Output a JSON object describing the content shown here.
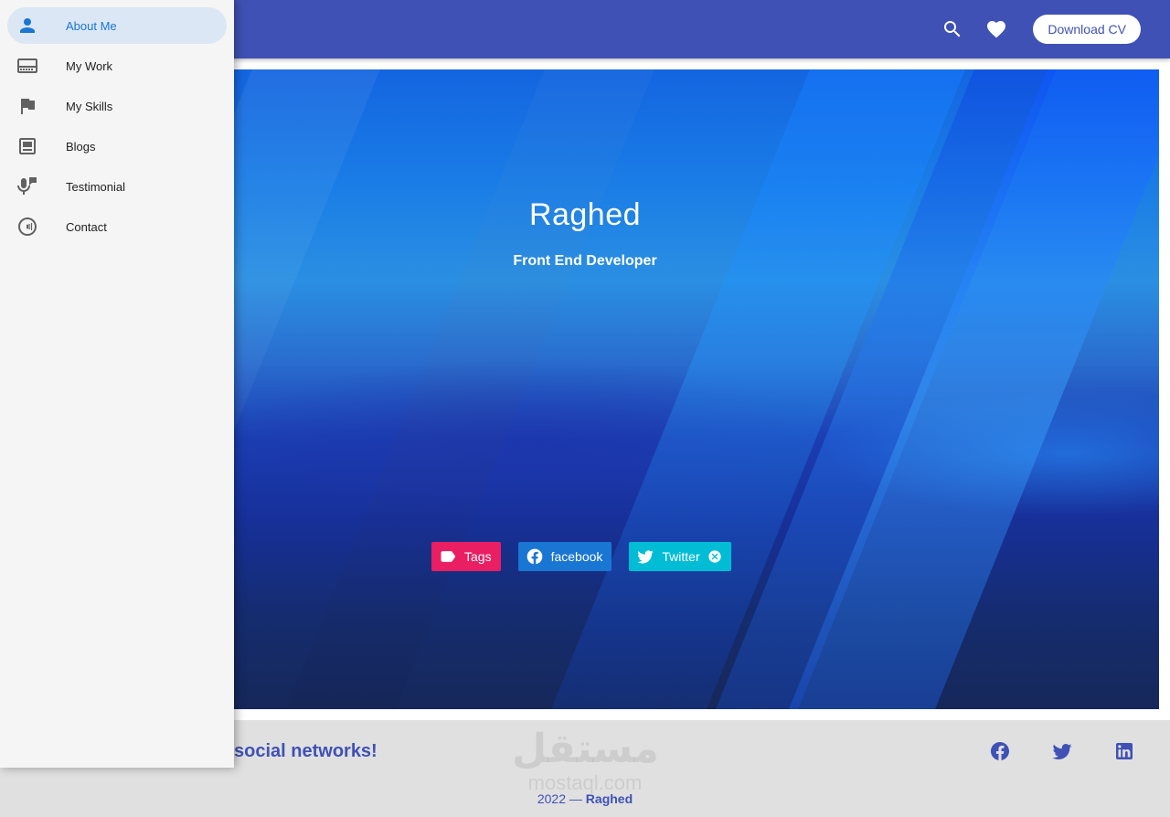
{
  "app_bar": {
    "search_icon": "search-icon",
    "favorite_icon": "heart-icon",
    "download_label": "Download CV",
    "color": "#3f51b5"
  },
  "drawer": {
    "items": [
      {
        "label": "About Me",
        "icon": "person-icon",
        "active": true
      },
      {
        "label": "My Work",
        "icon": "work-display-icon",
        "active": false
      },
      {
        "label": "My Skills",
        "icon": "flag-icon",
        "active": false
      },
      {
        "label": "Blogs",
        "icon": "article-icon",
        "active": false
      },
      {
        "label": "Testimonial",
        "icon": "mic-feedback-icon",
        "active": false
      },
      {
        "label": "Contact",
        "icon": "broadcast-icon",
        "active": false
      }
    ]
  },
  "hero": {
    "title": "Raghed",
    "subtitle": "Front End Developer",
    "chips": [
      {
        "label": "Tags",
        "icon": "label-icon",
        "color": "#e91e63"
      },
      {
        "label": "facebook",
        "icon": "facebook-icon",
        "color": "#1976d2"
      },
      {
        "label": "Twitter",
        "icon": "twitter-icon",
        "color": "#00bcd4",
        "closable": true
      }
    ]
  },
  "footer": {
    "text": "social networks!",
    "social_icons": [
      "facebook-icon",
      "twitter-icon",
      "linkedin-icon"
    ],
    "copyright_year": "2022 —",
    "copyright_name": "Raghed",
    "watermark_arabic": "مستقل",
    "watermark_latin": "mostaql.com"
  }
}
